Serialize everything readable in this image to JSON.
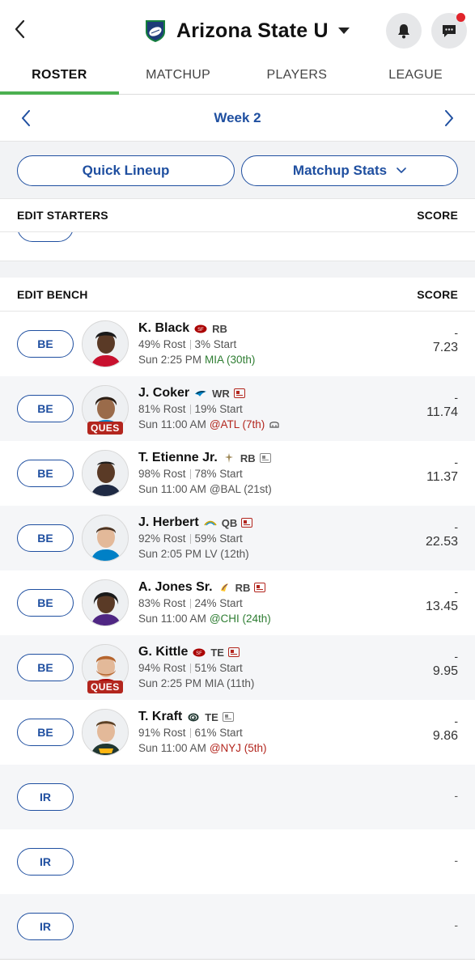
{
  "header": {
    "team_name": "Arizona State U",
    "back_icon": "chevron-left-icon",
    "bell_icon": "bell-icon",
    "chat_icon": "chat-icon",
    "notification_color": "#e1242b"
  },
  "tabs": [
    {
      "label": "ROSTER",
      "active": true
    },
    {
      "label": "MATCHUP",
      "active": false
    },
    {
      "label": "PLAYERS",
      "active": false
    },
    {
      "label": "LEAGUE",
      "active": false
    }
  ],
  "week_nav": {
    "label": "Week 2"
  },
  "controls": {
    "quick_lineup": "Quick Lineup",
    "matchup_stats": "Matchup Stats"
  },
  "starters": {
    "title": "EDIT STARTERS",
    "score_header": "SCORE"
  },
  "bench": {
    "title": "EDIT BENCH",
    "score_header": "SCORE",
    "players": [
      {
        "slot": "BE",
        "name": "K. Black",
        "position": "RB",
        "team_icon": "49ers-icon",
        "news": false,
        "status": "",
        "rost": "49% Rost",
        "start": "3% Start",
        "game_time": "Sun 2:25 PM",
        "opponent": "MIA (30th)",
        "opp_tone": "good",
        "weather": "",
        "score_dash": "-",
        "score": "7.23"
      },
      {
        "slot": "BE",
        "name": "J. Coker",
        "position": "WR",
        "team_icon": "panthers-icon",
        "news": true,
        "status": "QUES",
        "rost": "81% Rost",
        "start": "19% Start",
        "game_time": "Sun 11:00 AM",
        "opponent": "@ATL (7th)",
        "opp_tone": "bad",
        "weather": "dome-icon",
        "score_dash": "-",
        "score": "11.74"
      },
      {
        "slot": "BE",
        "name": "T. Etienne Jr.",
        "position": "RB",
        "team_icon": "saints-icon",
        "news": false,
        "status": "",
        "rost": "98% Rost",
        "start": "78% Start",
        "game_time": "Sun 11:00 AM",
        "opponent": "@BAL (21st)",
        "opp_tone": "neutral",
        "weather": "",
        "score_dash": "-",
        "score": "11.37"
      },
      {
        "slot": "BE",
        "name": "J. Herbert",
        "position": "QB",
        "team_icon": "chargers-icon",
        "news": true,
        "status": "",
        "rost": "92% Rost",
        "start": "59% Start",
        "game_time": "Sun 2:05 PM",
        "opponent": "LV (12th)",
        "opp_tone": "neutral",
        "weather": "",
        "score_dash": "-",
        "score": "22.53"
      },
      {
        "slot": "BE",
        "name": "A. Jones Sr.",
        "position": "RB",
        "team_icon": "vikings-icon",
        "news": true,
        "status": "",
        "rost": "83% Rost",
        "start": "24% Start",
        "game_time": "Sun 11:00 AM",
        "opponent": "@CHI (24th)",
        "opp_tone": "good",
        "weather": "",
        "score_dash": "-",
        "score": "13.45"
      },
      {
        "slot": "BE",
        "name": "G. Kittle",
        "position": "TE",
        "team_icon": "49ers-icon",
        "news": true,
        "status": "QUES",
        "rost": "94% Rost",
        "start": "51% Start",
        "game_time": "Sun 2:25 PM",
        "opponent": "MIA (11th)",
        "opp_tone": "neutral",
        "weather": "",
        "score_dash": "-",
        "score": "9.95"
      },
      {
        "slot": "BE",
        "name": "T. Kraft",
        "position": "TE",
        "team_icon": "packers-icon",
        "news": false,
        "status": "",
        "rost": "91% Rost",
        "start": "61% Start",
        "game_time": "Sun 11:00 AM",
        "opponent": "@NYJ (5th)",
        "opp_tone": "bad",
        "weather": "",
        "score_dash": "-",
        "score": "9.86"
      }
    ],
    "ir_slots": [
      {
        "slot": "IR",
        "score": "-"
      },
      {
        "slot": "IR",
        "score": "-"
      },
      {
        "slot": "IR",
        "score": "-"
      }
    ]
  }
}
